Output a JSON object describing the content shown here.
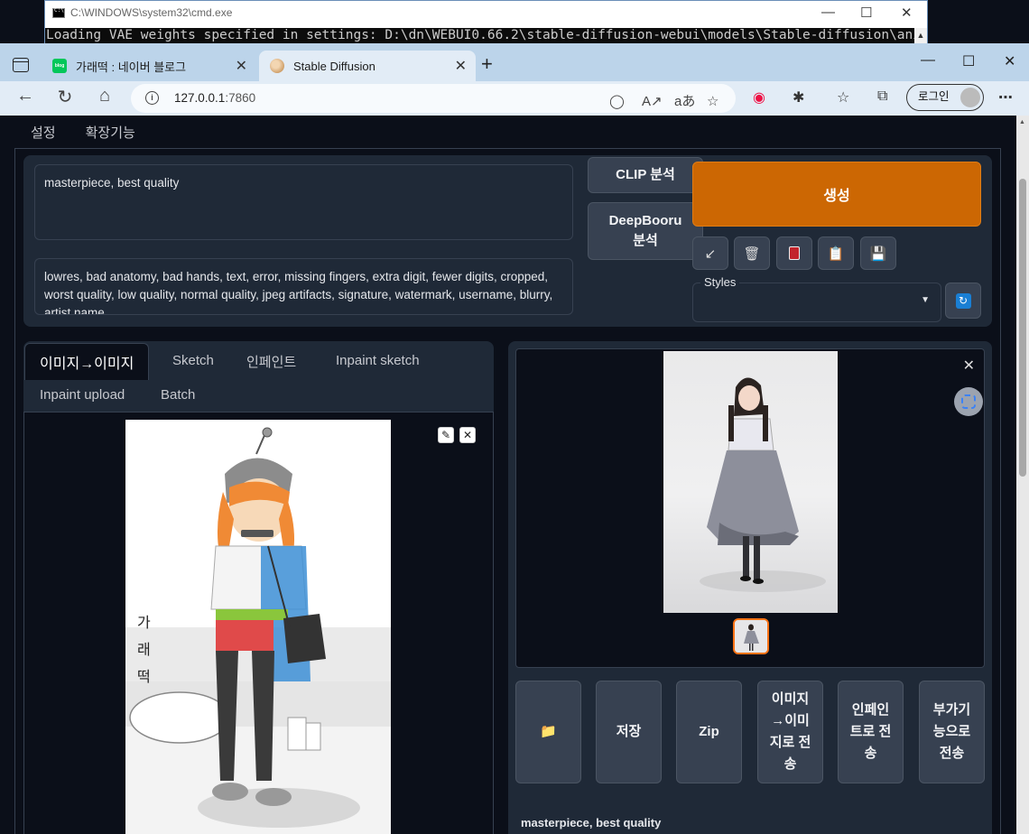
{
  "cmd_window": {
    "title": "C:\\WINDOWS\\system32\\cmd.exe",
    "output_line": "Loading VAE weights specified in settings: D:\\dn\\WEBUI0.66.2\\stable-diffusion-webui\\models\\Stable-diffusion\\animefull-fi"
  },
  "browser": {
    "tabs": [
      {
        "label": "가래떡 : 네이버 블로그",
        "favicon": "naver-blog-icon",
        "active": false
      },
      {
        "label": "Stable Diffusion",
        "favicon": "stable-diffusion-icon",
        "active": true
      }
    ],
    "url_host": "127.0.0.1",
    "url_port": ":7860",
    "login_label": "로그인"
  },
  "webui": {
    "top_nav": [
      "설정",
      "확장기능"
    ],
    "prompt": "masterpiece, best quality",
    "negative_prompt": "lowres, bad anatomy, bad hands, text, error, missing fingers, extra digit, fewer digits, cropped, worst quality, low quality, normal quality, jpeg artifacts, signature, watermark, username, blurry, artist name",
    "clip_button": "CLIP 분석",
    "deepbooru_button": "DeepBooru 분석",
    "generate_button": "생성",
    "tool_buttons": [
      "arrow-icon",
      "trash-icon",
      "card-icon",
      "clipboard-icon",
      "save-icon"
    ],
    "styles_label": "Styles",
    "input_tabs": [
      "이미지→이미지",
      "Sketch",
      "인페인트",
      "Inpaint sketch",
      "Inpaint upload",
      "Batch"
    ],
    "input_image_text": "가 래 떡",
    "output_buttons": [
      "📁",
      "저장",
      "Zip",
      "이미지→이미지로 전송",
      "인페인트로 전송",
      "부가기능으로 전송"
    ],
    "output_caption": "masterpiece, best quality",
    "colors": {
      "background": "#0b0f19",
      "panel": "#1f2937",
      "generate": "#cc6703",
      "selected_thumb": "#f97316"
    }
  }
}
